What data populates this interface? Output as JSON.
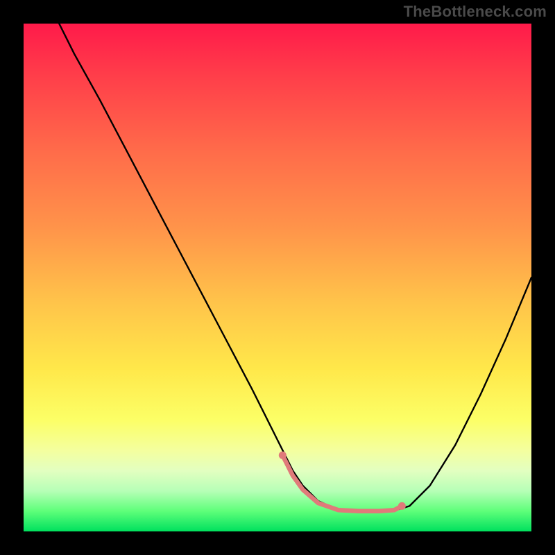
{
  "watermark": "TheBottleneck.com",
  "chart_data": {
    "type": "line",
    "title": "",
    "xlabel": "",
    "ylabel": "",
    "xlim": [
      0,
      100
    ],
    "ylim": [
      0,
      100
    ],
    "series": [
      {
        "name": "curve",
        "stroke": "#000000",
        "stroke_width": 2.4,
        "x": [
          7,
          10,
          15,
          20,
          25,
          30,
          35,
          40,
          45,
          50,
          53,
          55,
          58,
          62,
          66,
          70,
          73,
          76,
          80,
          85,
          90,
          95,
          100
        ],
        "values": [
          100,
          94,
          85,
          75.5,
          66,
          56.5,
          47,
          37.5,
          28,
          18,
          12,
          9,
          6,
          4.2,
          4,
          4,
          4.1,
          5,
          9,
          17,
          27,
          38,
          50
        ]
      },
      {
        "name": "optimal-highlight",
        "stroke": "#e07a7a",
        "stroke_width": 6.5,
        "x": [
          51,
          53,
          55,
          58,
          62,
          66,
          70,
          73,
          74.5
        ],
        "values": [
          15,
          11,
          8.2,
          5.6,
          4.2,
          4,
          4,
          4.2,
          5
        ]
      }
    ],
    "scatter": [
      {
        "name": "marker-start",
        "x": 51,
        "y": 15,
        "r": 5.5,
        "fill": "#e07a7a"
      },
      {
        "name": "marker-end",
        "x": 74.5,
        "y": 5,
        "r": 5.5,
        "fill": "#e07a7a"
      }
    ]
  }
}
